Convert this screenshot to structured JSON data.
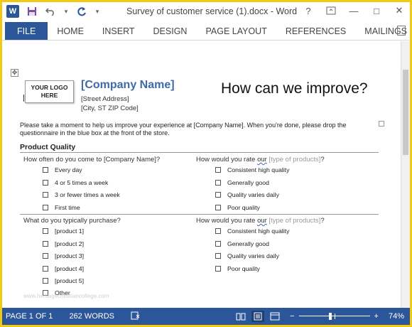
{
  "window": {
    "title": "Survey of customer service (1).docx - Word",
    "app_icon_letter": "W",
    "controls": {
      "help": "?",
      "minimize": "—",
      "maximize": "□",
      "close": "✕"
    }
  },
  "quick_access": {
    "more": "▾"
  },
  "ribbon": {
    "tabs": [
      "FILE",
      "HOME",
      "INSERT",
      "DESIGN",
      "PAGE LAYOUT",
      "REFERENCES",
      "MAILINGS",
      "R"
    ]
  },
  "document": {
    "move_handle": "✥",
    "logo_text": "YOUR LOGO HERE",
    "company_name": "[Company Name]",
    "street": "[Street Address]",
    "city": "[City, ST  ZIP Code]",
    "headline": "How can we improve?",
    "intro": "Please take a moment to help us improve your experience at [Company Name]. When you're done, please drop the questionnaire in the blue box at the front of the store.",
    "section_title": "Product Quality",
    "questions": [
      {
        "label": "How often do you come to [Company Name]?",
        "options": [
          "Every day",
          "4 or 5 times a week",
          "3 or fewer times a week",
          "First time"
        ]
      },
      {
        "label_prefix": "How would you rate ",
        "label_underlined": "our",
        "label_placeholder": " [type of products]",
        "label_suffix": "?",
        "options": [
          "Consistent high quality",
          "Generally good",
          "Quality varies daily",
          "Poor quality"
        ]
      },
      {
        "label": "What do you typically purchase?",
        "options": [
          "[product 1]",
          "[product 2]",
          "[product 3]",
          "[product 4]",
          "[product 5]",
          "Other"
        ]
      },
      {
        "label_prefix": "How would you rate ",
        "label_underlined": "our",
        "label_placeholder": " [type of products]",
        "label_suffix": "?",
        "options": [
          "Consistent high quality",
          "Generally good",
          "Quality varies daily",
          "Poor quality"
        ]
      }
    ],
    "watermark": "www.heritagechristiancollege.com"
  },
  "statusbar": {
    "page": "PAGE 1 OF 1",
    "words": "262 WORDS",
    "zoom_minus": "−",
    "zoom_plus": "+",
    "zoom": "74%",
    "zoom_fraction": 0.74
  }
}
